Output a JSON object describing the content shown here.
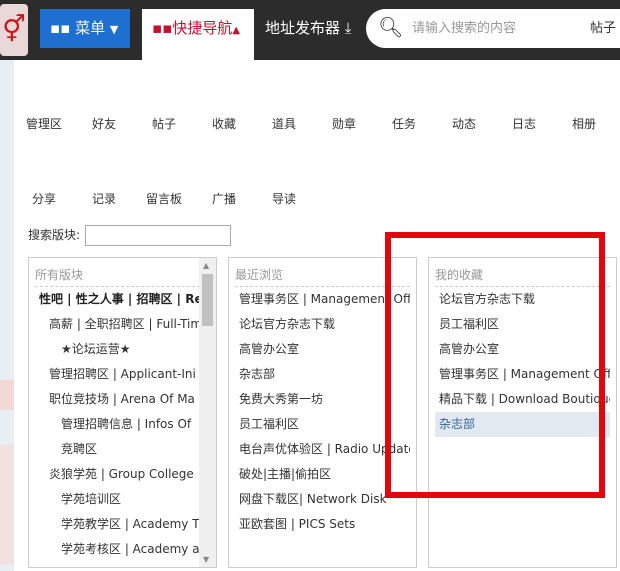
{
  "header": {
    "menu": "菜单",
    "quick_nav": "快捷导航",
    "addr": "地址发布器",
    "search_placeholder": "请输入搜索的内容",
    "search_type": "帖子"
  },
  "nav_row1": [
    "管理区",
    "好友",
    "帖子",
    "收藏",
    "道具",
    "勋章",
    "任务",
    "动态",
    "日志",
    "相册"
  ],
  "nav_row2": [
    "分享",
    "记录",
    "留言板",
    "广播",
    "导读"
  ],
  "search_forum_label": "搜索版块:",
  "panels": {
    "all": {
      "title": "所有版块",
      "items": [
        {
          "label": "性吧 | 性之人事 | 招聘区 | Re",
          "level": "b"
        },
        {
          "label": "高薪 | 全职招聘区 | Full-Time",
          "level": "l1"
        },
        {
          "label": "★论坛运营★",
          "level": "l2"
        },
        {
          "label": "管理招聘区 | Applicant-Ini",
          "level": "l1"
        },
        {
          "label": "职位竞技场 | Arena Of Ma",
          "level": "l1"
        },
        {
          "label": "管理招聘信息 | Infos Of",
          "level": "l2"
        },
        {
          "label": "竞聘区",
          "level": "l2"
        },
        {
          "label": "炎狼学苑 | Group College",
          "level": "l1"
        },
        {
          "label": "学苑培训区",
          "level": "l2"
        },
        {
          "label": "学苑教学区 | Academy T",
          "level": "l2"
        },
        {
          "label": "学苑考核区 | Academy a",
          "level": "l2"
        }
      ]
    },
    "recent": {
      "title": "最近浏览",
      "items": [
        "管理事务区 | Management Office",
        "论坛官方杂志下载",
        "高管办公室",
        "杂志部",
        "免费大秀第一坊",
        "员工福利区",
        "电台声优体验区 | Radio Update",
        "破处|主播|偷拍区",
        "网盘下载区| Network Disk",
        "亚欧套图 | PICS Sets"
      ]
    },
    "favorites": {
      "title": "我的收藏",
      "items": [
        "论坛官方杂志下载",
        "员工福利区",
        "高管办公室",
        "管理事务区 | Management Office",
        "精品下载 | Download Boutique",
        "杂志部"
      ]
    }
  }
}
